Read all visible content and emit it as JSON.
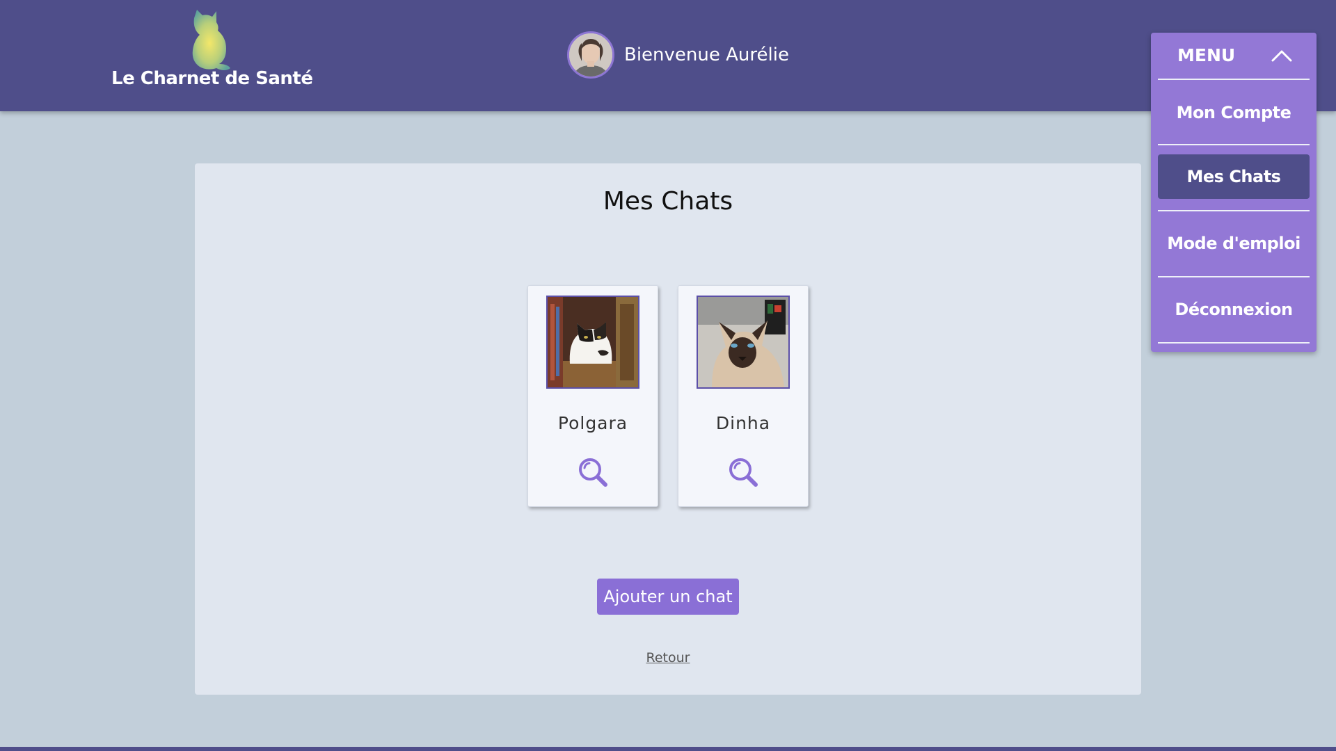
{
  "colors": {
    "header_bg": "#4f4e8a",
    "page_bg": "#c2cfda",
    "accent": "#9378d6",
    "button": "#8a6fd6",
    "card_bg": "#e0e6ef"
  },
  "header": {
    "logo_text": "Le Charnet de Santé",
    "logo_icon": "cat-silhouette-logo",
    "welcome_text": "Bienvenue Aurélie",
    "avatar_icon": "user-avatar"
  },
  "menu": {
    "title": "MENU",
    "toggle_icon": "chevron-up-icon",
    "items": [
      {
        "label": "Mon Compte",
        "active": false
      },
      {
        "label": "Mes Chats",
        "active": true
      },
      {
        "label": "Mode d'emploi",
        "active": false
      },
      {
        "label": "Déconnexion",
        "active": false
      }
    ]
  },
  "main": {
    "title": "Mes Chats",
    "cats": [
      {
        "name": "Polgara",
        "view_icon": "magnifier-icon"
      },
      {
        "name": "Dinha",
        "view_icon": "magnifier-icon"
      }
    ],
    "add_button": "Ajouter un chat",
    "back_link": "Retour"
  }
}
